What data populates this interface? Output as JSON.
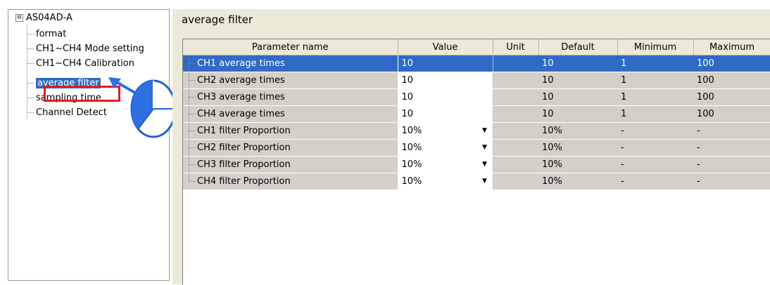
{
  "tree": {
    "root": "AS04AD-A",
    "expander": "⊟",
    "items": [
      {
        "label": "format"
      },
      {
        "label": "CH1~CH4 Mode setting"
      },
      {
        "label": "CH1~CH4 Calibration"
      },
      {
        "label": "average filter"
      },
      {
        "label": "sampling time"
      },
      {
        "label": "Channel Detect"
      }
    ]
  },
  "panel": {
    "title": "average filter",
    "columns": [
      "Parameter name",
      "Value",
      "Unit",
      "Default",
      "Minimum",
      "Maximum"
    ],
    "rows": [
      {
        "name": "CH1 average times",
        "value": "10",
        "unit": "",
        "default": "10",
        "minimum": "1",
        "maximum": "100"
      },
      {
        "name": "CH2 average times",
        "value": "10",
        "unit": "",
        "default": "10",
        "minimum": "1",
        "maximum": "100"
      },
      {
        "name": "CH3 average times",
        "value": "10",
        "unit": "",
        "default": "10",
        "minimum": "1",
        "maximum": "100"
      },
      {
        "name": "CH4 average times",
        "value": "10",
        "unit": "",
        "default": "10",
        "minimum": "1",
        "maximum": "100"
      },
      {
        "name": "CH1 filter Proportion",
        "value": "10%",
        "unit": "",
        "default": "10%",
        "minimum": "-",
        "maximum": "-"
      },
      {
        "name": "CH2 filter Proportion",
        "value": "10%",
        "unit": "",
        "default": "10%",
        "minimum": "-",
        "maximum": "-"
      },
      {
        "name": "CH3 filter Proportion",
        "value": "10%",
        "unit": "",
        "default": "10%",
        "minimum": "-",
        "maximum": "-"
      },
      {
        "name": "CH4 filter Proportion",
        "value": "10%",
        "unit": "",
        "default": "10%",
        "minimum": "-",
        "maximum": "-"
      }
    ],
    "dropdown_glyph": "▼"
  },
  "colors": {
    "selection": "#316ac5",
    "highlight": "#e21b23",
    "callout": "#2f6fe0"
  },
  "icons": [
    "mouse-left-click-icon",
    "pointer-arrow-icon",
    "dropdown-arrow-icon"
  ]
}
